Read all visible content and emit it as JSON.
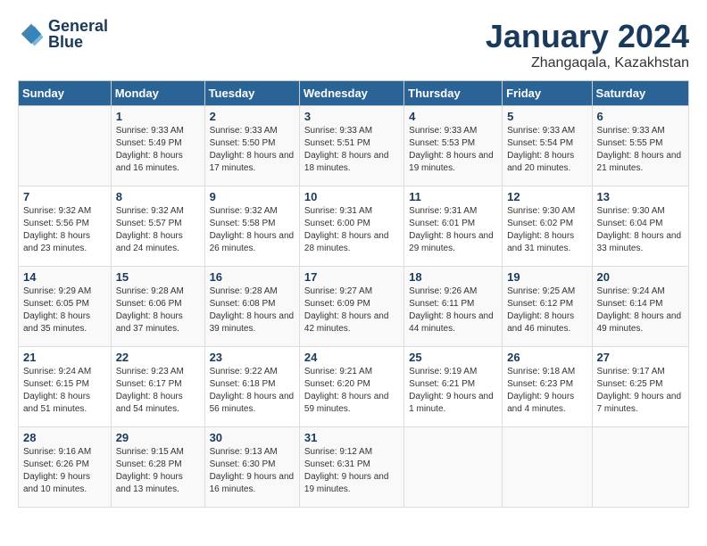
{
  "header": {
    "logo_line1": "General",
    "logo_line2": "Blue",
    "month": "January 2024",
    "location": "Zhangaqala, Kazakhstan"
  },
  "days_of_week": [
    "Sunday",
    "Monday",
    "Tuesday",
    "Wednesday",
    "Thursday",
    "Friday",
    "Saturday"
  ],
  "weeks": [
    [
      {
        "day": "",
        "sunrise": "",
        "sunset": "",
        "daylight": ""
      },
      {
        "day": "1",
        "sunrise": "9:33 AM",
        "sunset": "5:49 PM",
        "daylight": "8 hours and 16 minutes."
      },
      {
        "day": "2",
        "sunrise": "9:33 AM",
        "sunset": "5:50 PM",
        "daylight": "8 hours and 17 minutes."
      },
      {
        "day": "3",
        "sunrise": "9:33 AM",
        "sunset": "5:51 PM",
        "daylight": "8 hours and 18 minutes."
      },
      {
        "day": "4",
        "sunrise": "9:33 AM",
        "sunset": "5:53 PM",
        "daylight": "8 hours and 19 minutes."
      },
      {
        "day": "5",
        "sunrise": "9:33 AM",
        "sunset": "5:54 PM",
        "daylight": "8 hours and 20 minutes."
      },
      {
        "day": "6",
        "sunrise": "9:33 AM",
        "sunset": "5:55 PM",
        "daylight": "8 hours and 21 minutes."
      }
    ],
    [
      {
        "day": "7",
        "sunrise": "9:32 AM",
        "sunset": "5:56 PM",
        "daylight": "8 hours and 23 minutes."
      },
      {
        "day": "8",
        "sunrise": "9:32 AM",
        "sunset": "5:57 PM",
        "daylight": "8 hours and 24 minutes."
      },
      {
        "day": "9",
        "sunrise": "9:32 AM",
        "sunset": "5:58 PM",
        "daylight": "8 hours and 26 minutes."
      },
      {
        "day": "10",
        "sunrise": "9:31 AM",
        "sunset": "6:00 PM",
        "daylight": "8 hours and 28 minutes."
      },
      {
        "day": "11",
        "sunrise": "9:31 AM",
        "sunset": "6:01 PM",
        "daylight": "8 hours and 29 minutes."
      },
      {
        "day": "12",
        "sunrise": "9:30 AM",
        "sunset": "6:02 PM",
        "daylight": "8 hours and 31 minutes."
      },
      {
        "day": "13",
        "sunrise": "9:30 AM",
        "sunset": "6:04 PM",
        "daylight": "8 hours and 33 minutes."
      }
    ],
    [
      {
        "day": "14",
        "sunrise": "9:29 AM",
        "sunset": "6:05 PM",
        "daylight": "8 hours and 35 minutes."
      },
      {
        "day": "15",
        "sunrise": "9:28 AM",
        "sunset": "6:06 PM",
        "daylight": "8 hours and 37 minutes."
      },
      {
        "day": "16",
        "sunrise": "9:28 AM",
        "sunset": "6:08 PM",
        "daylight": "8 hours and 39 minutes."
      },
      {
        "day": "17",
        "sunrise": "9:27 AM",
        "sunset": "6:09 PM",
        "daylight": "8 hours and 42 minutes."
      },
      {
        "day": "18",
        "sunrise": "9:26 AM",
        "sunset": "6:11 PM",
        "daylight": "8 hours and 44 minutes."
      },
      {
        "day": "19",
        "sunrise": "9:25 AM",
        "sunset": "6:12 PM",
        "daylight": "8 hours and 46 minutes."
      },
      {
        "day": "20",
        "sunrise": "9:24 AM",
        "sunset": "6:14 PM",
        "daylight": "8 hours and 49 minutes."
      }
    ],
    [
      {
        "day": "21",
        "sunrise": "9:24 AM",
        "sunset": "6:15 PM",
        "daylight": "8 hours and 51 minutes."
      },
      {
        "day": "22",
        "sunrise": "9:23 AM",
        "sunset": "6:17 PM",
        "daylight": "8 hours and 54 minutes."
      },
      {
        "day": "23",
        "sunrise": "9:22 AM",
        "sunset": "6:18 PM",
        "daylight": "8 hours and 56 minutes."
      },
      {
        "day": "24",
        "sunrise": "9:21 AM",
        "sunset": "6:20 PM",
        "daylight": "8 hours and 59 minutes."
      },
      {
        "day": "25",
        "sunrise": "9:19 AM",
        "sunset": "6:21 PM",
        "daylight": "9 hours and 1 minute."
      },
      {
        "day": "26",
        "sunrise": "9:18 AM",
        "sunset": "6:23 PM",
        "daylight": "9 hours and 4 minutes."
      },
      {
        "day": "27",
        "sunrise": "9:17 AM",
        "sunset": "6:25 PM",
        "daylight": "9 hours and 7 minutes."
      }
    ],
    [
      {
        "day": "28",
        "sunrise": "9:16 AM",
        "sunset": "6:26 PM",
        "daylight": "9 hours and 10 minutes."
      },
      {
        "day": "29",
        "sunrise": "9:15 AM",
        "sunset": "6:28 PM",
        "daylight": "9 hours and 13 minutes."
      },
      {
        "day": "30",
        "sunrise": "9:13 AM",
        "sunset": "6:30 PM",
        "daylight": "9 hours and 16 minutes."
      },
      {
        "day": "31",
        "sunrise": "9:12 AM",
        "sunset": "6:31 PM",
        "daylight": "9 hours and 19 minutes."
      },
      {
        "day": "",
        "sunrise": "",
        "sunset": "",
        "daylight": ""
      },
      {
        "day": "",
        "sunrise": "",
        "sunset": "",
        "daylight": ""
      },
      {
        "day": "",
        "sunrise": "",
        "sunset": "",
        "daylight": ""
      }
    ]
  ]
}
